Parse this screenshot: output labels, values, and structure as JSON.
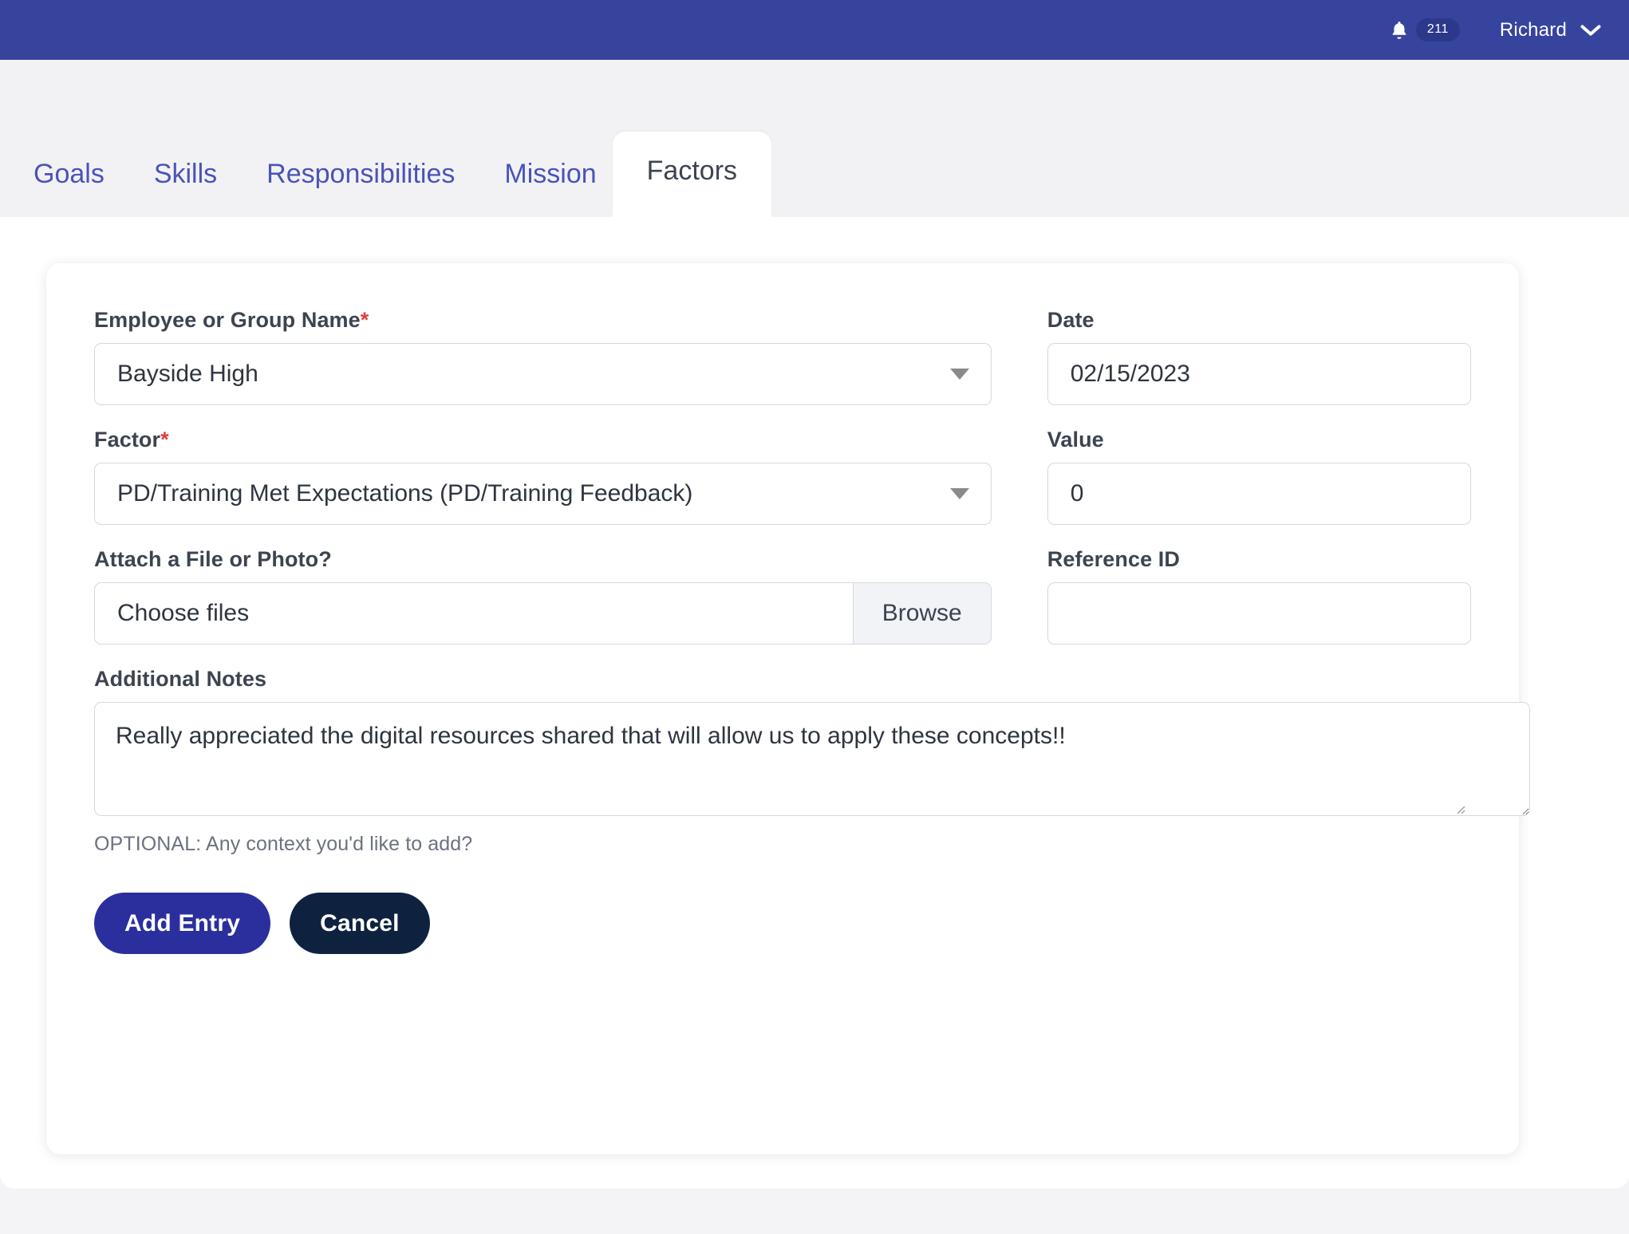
{
  "topbar": {
    "bell_icon": "bell-icon",
    "notification_count": "211",
    "user_name": "Richard",
    "chevron_icon": "chevron-down-icon",
    "background_color": "#36449e"
  },
  "tabs": [
    {
      "label": "Goals",
      "active": false
    },
    {
      "label": "Skills",
      "active": false
    },
    {
      "label": "Responsibilities",
      "active": false
    },
    {
      "label": "Mission",
      "active": false
    },
    {
      "label": "Factors",
      "active": true
    }
  ],
  "form": {
    "employee_group": {
      "label": "Employee or Group Name",
      "required_marker": "*",
      "value": "Bayside High"
    },
    "date": {
      "label": "Date",
      "value": "02/15/2023"
    },
    "factor": {
      "label": "Factor",
      "required_marker": "*",
      "value": "PD/Training Met Expectations (PD/Training Feedback)"
    },
    "value": {
      "label": "Value",
      "value": "0"
    },
    "attachment": {
      "label": "Attach a File or Photo?",
      "file_text": "Choose files",
      "browse_label": "Browse"
    },
    "reference_id": {
      "label": "Reference ID",
      "value": ""
    },
    "notes": {
      "label": "Additional Notes",
      "value": "Really appreciated the digital resources shared that will allow us to apply these concepts!!",
      "hint": "OPTIONAL: Any context you'd like to add?"
    },
    "actions": {
      "submit_label": "Add Entry",
      "cancel_label": "Cancel",
      "submit_color": "#2b2f9e",
      "cancel_color": "#0e2240"
    }
  }
}
